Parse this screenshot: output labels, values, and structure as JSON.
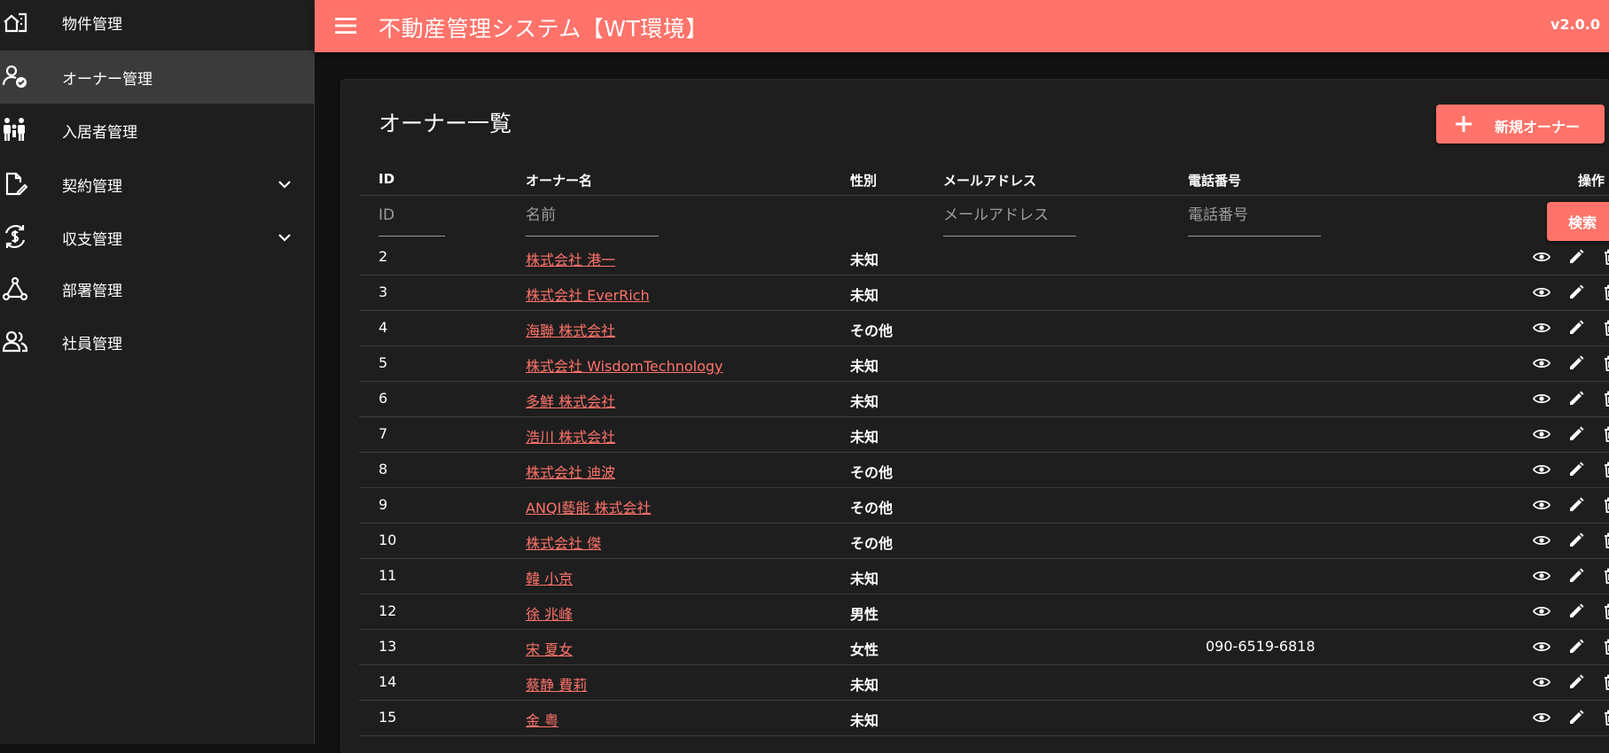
{
  "sidebar": {
    "items": [
      {
        "label": "物件管理",
        "icon": "building-icon"
      },
      {
        "label": "オーナー管理",
        "icon": "owner-check-icon",
        "active": true
      },
      {
        "label": "入居者管理",
        "icon": "family-icon"
      },
      {
        "label": "契約管理",
        "icon": "contract-edit-icon",
        "expandable": true
      },
      {
        "label": "収支管理",
        "icon": "currency-sync-icon",
        "expandable": true
      },
      {
        "label": "部署管理",
        "icon": "hierarchy-icon"
      },
      {
        "label": "社員管理",
        "icon": "people-icon"
      }
    ]
  },
  "header": {
    "title": "不動産管理システム【WT環境】",
    "version": "v2.0.0"
  },
  "main": {
    "title": "オーナー一覧",
    "add_button": "新規オーナー",
    "columns": {
      "id": "ID",
      "name": "オーナー名",
      "gender": "性別",
      "email": "メールアドレス",
      "phone": "電話番号",
      "actions": "操作"
    },
    "filters": {
      "id_placeholder": "ID",
      "name_placeholder": "名前",
      "email_placeholder": "メールアドレス",
      "phone_placeholder": "電話番号",
      "search_button": "検索"
    },
    "rows": [
      {
        "id": "2",
        "name": "株式会社 港一",
        "gender": "未知",
        "email": "",
        "phone": ""
      },
      {
        "id": "3",
        "name": "株式会社 EverRich",
        "gender": "未知",
        "email": "",
        "phone": ""
      },
      {
        "id": "4",
        "name": "海聯 株式会社",
        "gender": "その他",
        "email": "",
        "phone": ""
      },
      {
        "id": "5",
        "name": "株式会社 WisdomTechnology",
        "gender": "未知",
        "email": "",
        "phone": ""
      },
      {
        "id": "6",
        "name": "多鮮 株式会社",
        "gender": "未知",
        "email": "",
        "phone": ""
      },
      {
        "id": "7",
        "name": "浩川 株式会社",
        "gender": "未知",
        "email": "",
        "phone": ""
      },
      {
        "id": "8",
        "name": "株式会社 迪波",
        "gender": "その他",
        "email": "",
        "phone": ""
      },
      {
        "id": "9",
        "name": "ANQI藝能 株式会社",
        "gender": "その他",
        "email": "",
        "phone": ""
      },
      {
        "id": "10",
        "name": "株式会社 傑",
        "gender": "その他",
        "email": "",
        "phone": ""
      },
      {
        "id": "11",
        "name": "韓 小京",
        "gender": "未知",
        "email": "",
        "phone": ""
      },
      {
        "id": "12",
        "name": "徐 兆峰",
        "gender": "男性",
        "email": "",
        "phone": ""
      },
      {
        "id": "13",
        "name": "宋 夏女",
        "gender": "女性",
        "email": "",
        "phone": "090-6519-6818"
      },
      {
        "id": "14",
        "name": "蔡静 費莉",
        "gender": "未知",
        "email": "",
        "phone": ""
      },
      {
        "id": "15",
        "name": "金 粤",
        "gender": "未知",
        "email": "",
        "phone": ""
      }
    ]
  },
  "colors": {
    "accent": "#ff736a",
    "background": "#121212",
    "surface": "#1e1e1e",
    "sidebar_active": "#3b3b3b"
  }
}
